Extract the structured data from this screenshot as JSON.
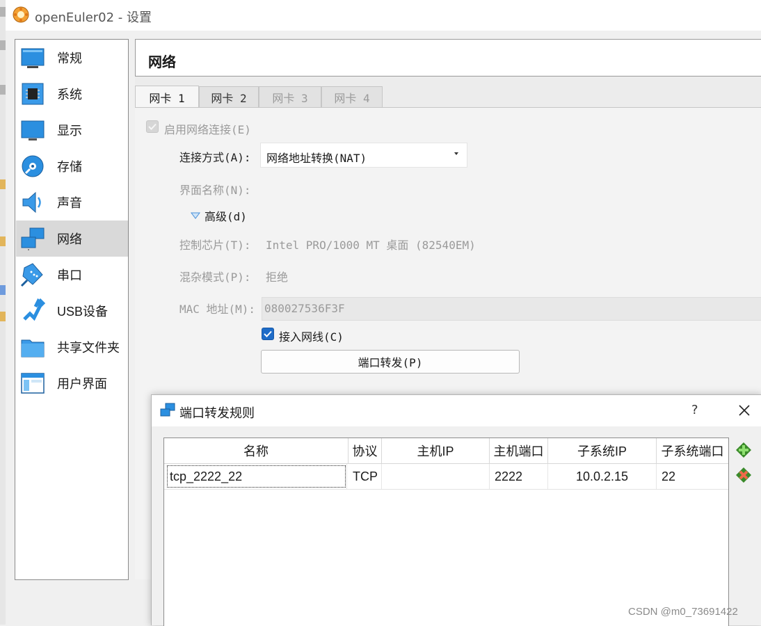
{
  "window": {
    "title": "openEuler02 - 设置"
  },
  "sidebar": {
    "items": [
      {
        "label": "常规",
        "icon": "general-icon"
      },
      {
        "label": "系统",
        "icon": "chip-icon"
      },
      {
        "label": "显示",
        "icon": "monitor-icon"
      },
      {
        "label": "存储",
        "icon": "disk-icon"
      },
      {
        "label": "声音",
        "icon": "speaker-icon"
      },
      {
        "label": "网络",
        "icon": "network-icon"
      },
      {
        "label": "串口",
        "icon": "serial-port-icon"
      },
      {
        "label": "USB设备",
        "icon": "usb-icon"
      },
      {
        "label": "共享文件夹",
        "icon": "folder-icon"
      },
      {
        "label": "用户界面",
        "icon": "window-icon"
      }
    ],
    "selected": "网络"
  },
  "page": {
    "title": "网络"
  },
  "tabs": [
    {
      "label": "网卡 1",
      "state": "active"
    },
    {
      "label": "网卡 2",
      "state": "inactive"
    },
    {
      "label": "网卡 3",
      "state": "disabled"
    },
    {
      "label": "网卡 4",
      "state": "disabled"
    }
  ],
  "adapter": {
    "enable_label": "启用网络连接(E)",
    "attached_label": "连接方式(A):",
    "attached_value": "网络地址转换(NAT)",
    "name_label": "界面名称(N):",
    "advanced_label": "高级(d)",
    "chip_label": "控制芯片(T):",
    "chip_value": "Intel PRO/1000 MT 桌面 (82540EM)",
    "promisc_label": "混杂模式(P):",
    "promisc_value": "拒绝",
    "mac_label": "MAC 地址(M):",
    "mac_value": "080027536F3F",
    "cable_label": "接入网线(C)",
    "port_forward_button": "端口转发(P)"
  },
  "dialog": {
    "title": "端口转发规则",
    "help": "?",
    "columns": [
      "名称",
      "协议",
      "主机IP",
      "主机端口",
      "子系统IP",
      "子系统端口"
    ],
    "rows": [
      {
        "name": "tcp_2222_22",
        "protocol": "TCP",
        "host_ip": "",
        "host_port": "2222",
        "guest_ip": "10.0.2.15",
        "guest_port": "22"
      }
    ]
  },
  "watermark": "CSDN @m0_73691422",
  "colors": {
    "accent": "#1e6cc8",
    "selected_bg": "#d9d9d9"
  }
}
